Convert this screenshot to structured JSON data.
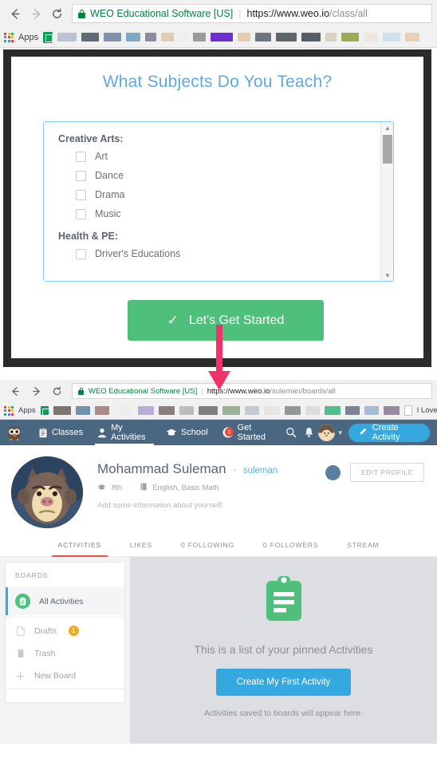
{
  "window1": {
    "browser": {
      "back_icon": "arrow-left-icon",
      "forward_icon": "arrow-right-icon",
      "reload_icon": "reload-icon",
      "lock_icon": "lock-icon",
      "site_name": "WEO Educational Software [US]",
      "url_domain": "https://www.weo.io",
      "url_path": "/class/all",
      "apps_label": "Apps"
    },
    "modal": {
      "title": "What Subjects Do You Teach?",
      "groups": [
        {
          "title": "Creative Arts:",
          "items": [
            "Art",
            "Dance",
            "Drama",
            "Music"
          ]
        },
        {
          "title": "Health & PE:",
          "items": [
            "Driver's Educations"
          ]
        }
      ],
      "scroll_up_icon": "triangle-up-icon",
      "scroll_down_icon": "triangle-down-icon",
      "start_button": {
        "label": "Let's Get Started",
        "icon": "check-icon",
        "color": "#4fc07c"
      }
    }
  },
  "window2": {
    "browser": {
      "back_icon": "arrow-left-icon",
      "forward_icon": "arrow-right-icon",
      "reload_icon": "reload-icon",
      "lock_icon": "lock-icon",
      "site_name": "WEO Educational Software [US]",
      "url_domain": "https://www.weo.io",
      "url_path": "/suleman/boards/all",
      "apps_label": "Apps",
      "bookmark_label": "I Love Free Software"
    },
    "appnav": {
      "logo_icon": "owl-logo-icon",
      "items": [
        {
          "label": "Classes",
          "icon": "clipboard-icon",
          "active": false,
          "badge": ""
        },
        {
          "label": "My Activities",
          "icon": "person-icon",
          "active": true,
          "badge": ""
        },
        {
          "label": "School",
          "icon": "graduation-cap-icon",
          "active": false,
          "badge": ""
        },
        {
          "label": "Get Started",
          "icon": "star-icon",
          "active": false,
          "badge": "3"
        }
      ],
      "search_icon": "search-icon",
      "bell_icon": "bell-icon",
      "avatar_icon": "user-avatar-icon",
      "caret_icon": "chevron-down-icon",
      "create_button": {
        "label": "Create Activity",
        "icon": "pencil-icon",
        "color": "#35a8e0"
      }
    },
    "profile": {
      "avatar_icon": "gorilla-avatar-icon",
      "name": "Mohammad Suleman",
      "separator": "·",
      "handle": "suleman",
      "grade_icon": "graduation-cap-icon",
      "grade": "8th",
      "subject_icon": "book-icon",
      "subjects": "English, Basic Math",
      "bio_placeholder": "Add some information about yourself!",
      "status_dot_icon": "status-circle-icon",
      "edit_button": "EDIT PROFILE"
    },
    "tabs": [
      {
        "label": "ACTIVITIES",
        "active": true
      },
      {
        "label": "LIKES",
        "active": false
      },
      {
        "label": "0 FOLLOWING",
        "active": false
      },
      {
        "label": "0 FOLLOWERS",
        "active": false
      },
      {
        "label": "STREAM",
        "active": false
      }
    ],
    "sidebar": {
      "heading": "BOARDS",
      "items": [
        {
          "label": "All Activities",
          "icon": "clipboard-circle-icon",
          "active": true,
          "badge": ""
        },
        {
          "label": "Drafts",
          "icon": "file-icon",
          "active": false,
          "badge": "1"
        },
        {
          "label": "Trash",
          "icon": "trash-icon",
          "active": false,
          "badge": ""
        },
        {
          "label": "New Board",
          "icon": "plus-icon",
          "active": false,
          "badge": ""
        }
      ]
    },
    "empty_state": {
      "icon": "clipboard-icon",
      "heading": "This is a list of your pinned Activities",
      "button": "Create My First Activity",
      "subtext": "Activities saved to boards will appear here."
    }
  },
  "annotation": {
    "arrow_icon": "down-arrow-annotation",
    "color": "#f0326a"
  },
  "palette": {
    "nav_bg": "#4a6781",
    "accent_blue": "#35a8e0",
    "accent_green": "#4fc07c",
    "title_blue": "#62a8dd",
    "tab_underline": "#e8553f",
    "badge_red": "#e8453c",
    "badge_amber": "#f0ad1e"
  }
}
